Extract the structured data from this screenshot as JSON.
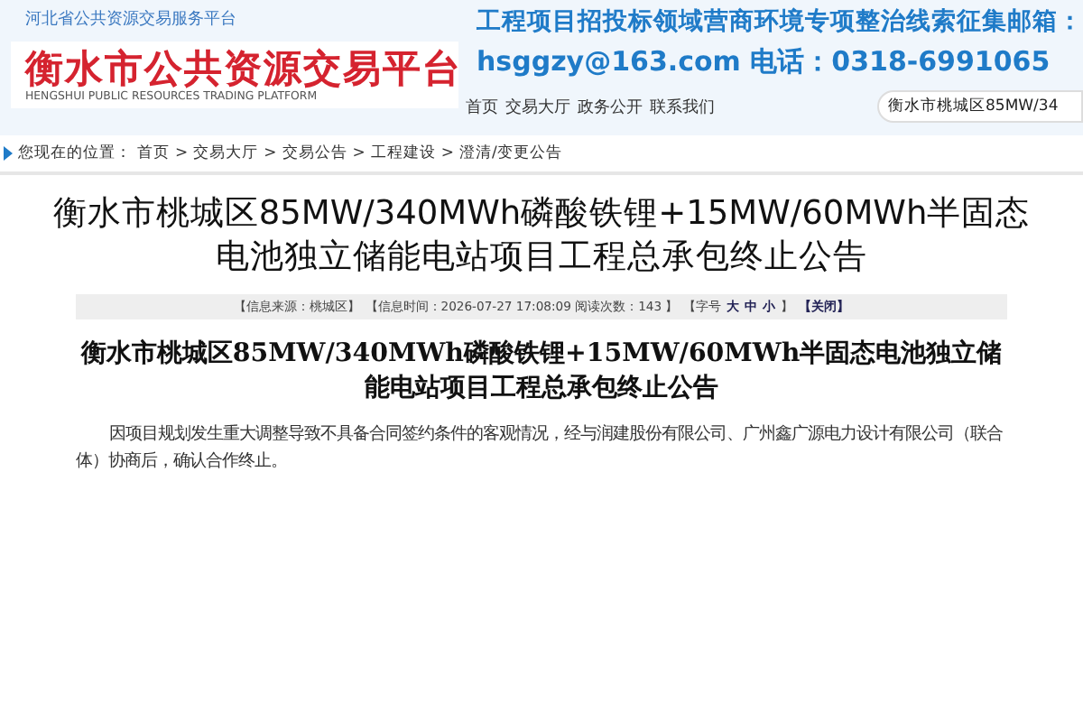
{
  "header": {
    "top_link": "河北省公共资源交易服务平台",
    "logo_title": "衡水市公共资源交易平台",
    "logo_subtitle": "HENGSHUI PUBLIC RESOURCES TRADING PLATFORM",
    "banner_lines": [
      "工程项目招投标领域营商环境专项整治线索征集邮箱：",
      "hsggzy@163.com 电话：0318-6991065"
    ],
    "nav": [
      "首页",
      "交易大厅",
      "政务公开",
      "联系我们"
    ],
    "search": {
      "value": "衡水市桃城区85MW/34"
    }
  },
  "breadcrumb": {
    "label": "您现在的位置：",
    "items": [
      "首页",
      "交易大厅",
      "交易公告",
      "工程建设",
      "澄清/变更公告"
    ],
    "separator": ">"
  },
  "article": {
    "title": "衡水市桃城区85MW/340MWh磷酸铁锂+15MW/60MWh半固态电池独立储能电站项目工程总承包终止公告",
    "info": [
      {
        "kind": "text",
        "text": "【信息来源：桃城区】"
      },
      {
        "kind": "text",
        "text": "【信息时间：2026-07-27 17:08:09 阅读次数：143 】"
      },
      {
        "kind": "text",
        "text": "【字号"
      },
      {
        "kind": "link",
        "text": "大"
      },
      {
        "kind": "link",
        "text": "中"
      },
      {
        "kind": "link",
        "text": "小"
      },
      {
        "kind": "text",
        "text": "】"
      },
      {
        "kind": "link",
        "text": "【关闭】"
      }
    ],
    "doc_title": "衡水市桃城区85MW/340MWh磷酸铁锂+15MW/60MWh半固态电池独立储能电站项目工程总承包终止公告",
    "body": "因项目规划发生重大调整导致不具备合同签约条件的客观情况，经与润建股份有限公司、广州鑫广源电力设计有限公司（联合体）协商后，确认合作终止。"
  }
}
